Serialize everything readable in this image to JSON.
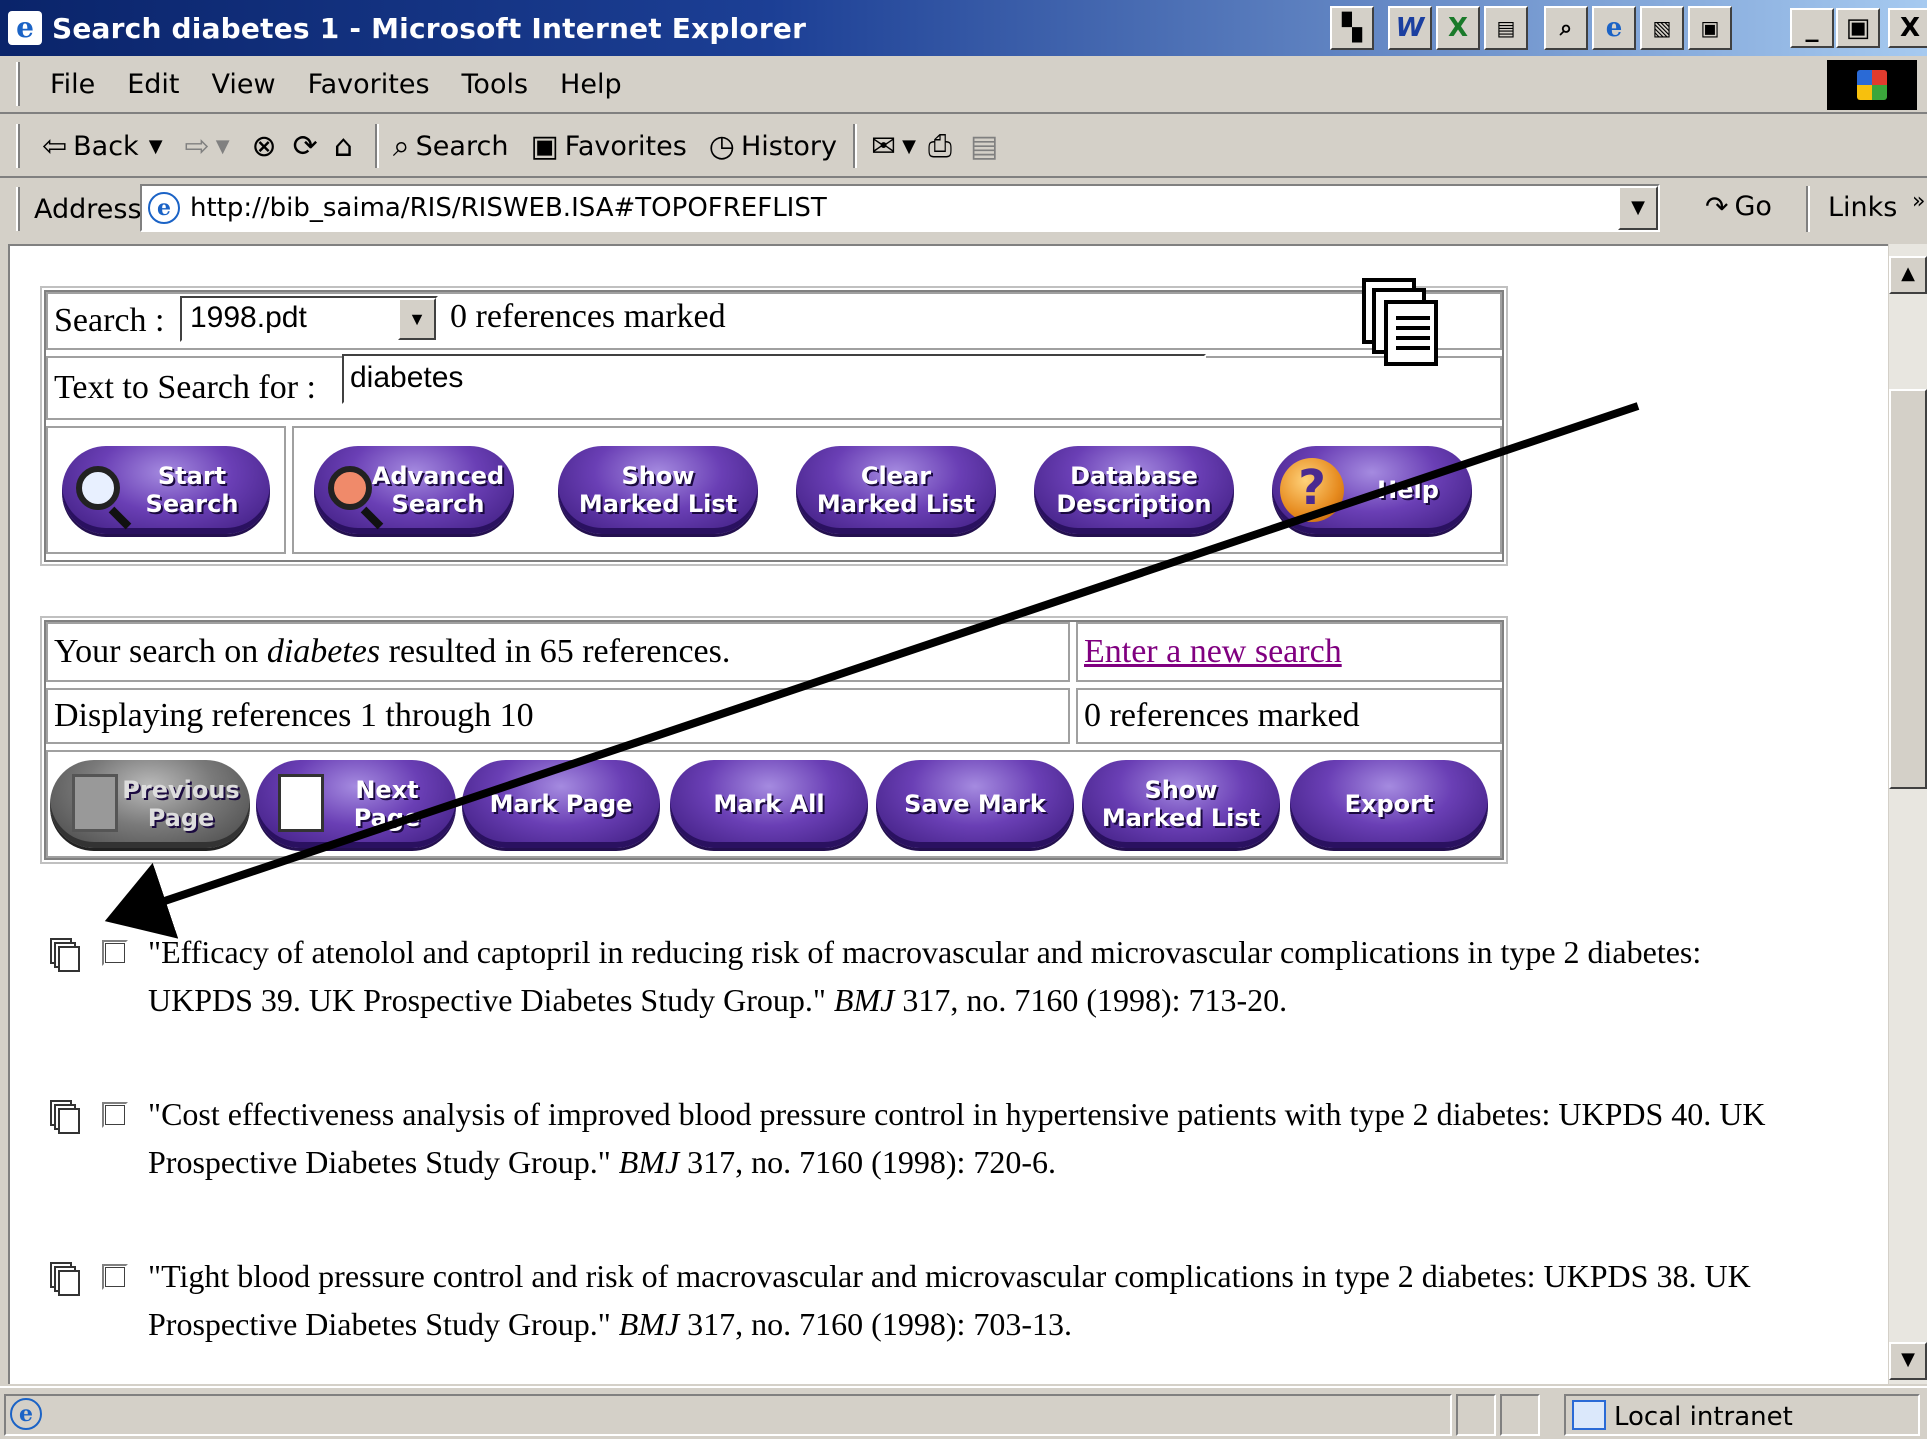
{
  "window": {
    "title": "Search diabetes 1 - Microsoft Internet Explorer",
    "app_icon": "ie-icon",
    "tray_icons": [
      "colors-icon",
      "word-icon",
      "excel-icon",
      "powerpoint-icon",
      "find-icon",
      "ie-icon",
      "chart-icon",
      "photo-icon"
    ],
    "controls": {
      "minimize": "_",
      "maximize": "▣",
      "close": "X"
    }
  },
  "menu": {
    "items": [
      "File",
      "Edit",
      "View",
      "Favorites",
      "Tools",
      "Help"
    ]
  },
  "toolbar": {
    "back_label": "Back",
    "search_label": "Search",
    "favorites_label": "Favorites",
    "history_label": "History"
  },
  "address": {
    "label": "Address",
    "url": "http://bib_saima/RIS/RISWEB.ISA#TOPOFREFLIST",
    "go_label": "Go",
    "links_label": "Links",
    "links_more": "»"
  },
  "search_form": {
    "search_label": "Search :",
    "database_selected": "1998.pdt",
    "marked_count_text": "0 references marked",
    "text_label": "Text to Search for :",
    "text_value": "diabetes",
    "buttons": [
      {
        "line1": "Start",
        "line2": "Search"
      },
      {
        "line1": "Advanced",
        "line2": "Search"
      },
      {
        "line1": "Show",
        "line2": "Marked List"
      },
      {
        "line1": "Clear",
        "line2": "Marked List"
      },
      {
        "line1": "Database",
        "line2": "Description"
      },
      {
        "line1": "Help",
        "line2": ""
      }
    ]
  },
  "results_header": {
    "summary_prefix": "Your search on ",
    "summary_term": "diabetes",
    "summary_suffix": " resulted in 65 references.",
    "new_search_link": "Enter a new search",
    "displaying_text": "Displaying references 1 through 10",
    "marked_text": "0 references marked",
    "nav_buttons": [
      {
        "line1": "Previous",
        "line2": "Page",
        "enabled": false
      },
      {
        "line1": "Next",
        "line2": "Page",
        "enabled": true
      },
      {
        "line1": "Mark Page",
        "line2": "",
        "enabled": true
      },
      {
        "line1": "Mark All",
        "line2": "",
        "enabled": true
      },
      {
        "line1": "Save Mark",
        "line2": "",
        "enabled": true
      },
      {
        "line1": "Show",
        "line2": "Marked List",
        "enabled": true
      },
      {
        "line1": "Export",
        "line2": "",
        "enabled": true
      }
    ]
  },
  "references": [
    {
      "title": "\"Efficacy of atenolol and captopril in reducing risk of macrovascular and microvascular complications in type 2 diabetes: UKPDS 39. UK Prospective Diabetes Study Group.\"",
      "journal": "BMJ",
      "citation": " 317, no. 7160 (1998): 713-20."
    },
    {
      "title": "\"Cost effectiveness analysis of improved blood pressure control in hypertensive patients with type 2 diabetes: UKPDS 40. UK Prospective Diabetes Study Group.\"",
      "journal": "BMJ",
      "citation": " 317, no. 7160 (1998): 720-6."
    },
    {
      "title": "\"Tight blood pressure control and risk of macrovascular and microvascular complications in type 2 diabetes: UKPDS 38. UK Prospective Diabetes Study Group.\"",
      "journal": "BMJ",
      "citation": " 317, no. 7160 (1998): 703-13."
    }
  ],
  "status": {
    "zone_text": "Local intranet"
  },
  "colors": {
    "title_bar": "#0a246a",
    "button_purple": "#6a3fb5",
    "visited_link": "#800080"
  }
}
